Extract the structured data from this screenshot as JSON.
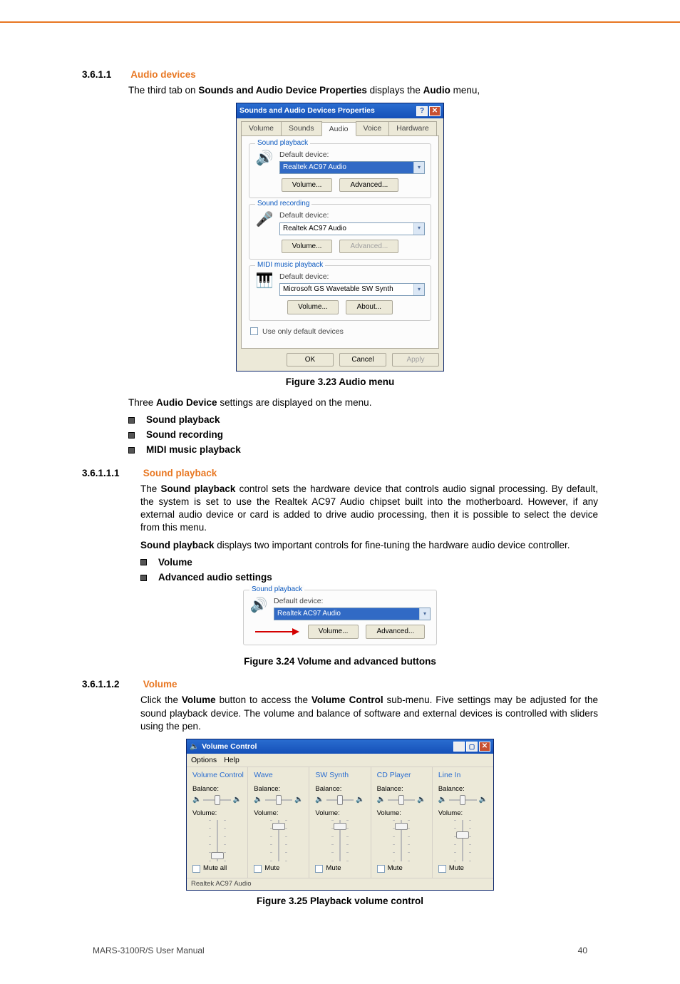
{
  "sections": {
    "s1": {
      "num": "3.6.1.1",
      "title": "Audio devices"
    },
    "s2": {
      "num": "3.6.1.1.1",
      "title": "Sound playback"
    },
    "s3": {
      "num": "3.6.1.1.2",
      "title": "Volume"
    }
  },
  "paras": {
    "p1a": "The third tab on ",
    "p1b": "Sounds and Audio Device Properties",
    "p1c": " displays the ",
    "p1d": "Audio",
    "p1e": " menu,",
    "p2a": "Three ",
    "p2b": "Audio Device",
    "p2c": " settings are displayed on the menu.",
    "p3a": "The ",
    "p3b": "Sound playback",
    "p3c": " control sets the hardware device that controls audio signal processing. By default, the system is set to use the Realtek AC97 Audio chipset built into the motherboard. However, if any external audio device or card is added to drive audio processing, then it is possible to select the device from this menu.",
    "p4a": "Sound playback",
    "p4b": " displays two important controls for fine-tuning the hardware audio device controller.",
    "p5a": "Click the ",
    "p5b": "Volume",
    "p5c": " button to access the ",
    "p5d": "Volume Control",
    "p5e": " sub-menu. Five settings may be adjusted for the sound playback device. The volume and balance of software and external devices is controlled with sliders using the pen."
  },
  "bullets1": [
    "Sound playback",
    "Sound recording",
    "MIDI music playback"
  ],
  "bullets2": [
    "Volume",
    "Advanced audio settings"
  ],
  "captions": {
    "c1": "Figure 3.23 Audio menu",
    "c2": "Figure 3.24 Volume and advanced buttons",
    "c3": "Figure 3.25 Playback volume control"
  },
  "dialog1": {
    "title": "Sounds and Audio Devices Properties",
    "tabs": [
      "Volume",
      "Sounds",
      "Audio",
      "Voice",
      "Hardware"
    ],
    "groups": {
      "g1": {
        "title": "Sound playback",
        "label": "Default device:",
        "device": "Realtek AC97 Audio",
        "btn1": "Volume...",
        "btn2": "Advanced..."
      },
      "g2": {
        "title": "Sound recording",
        "label": "Default device:",
        "device": "Realtek AC97 Audio",
        "btn1": "Volume...",
        "btn2": "Advanced..."
      },
      "g3": {
        "title": "MIDI music playback",
        "label": "Default device:",
        "device": "Microsoft GS Wavetable SW Synth",
        "btn1": "Volume...",
        "btn2": "About..."
      }
    },
    "useOnly": "Use only default devices",
    "ok": "OK",
    "cancel": "Cancel",
    "apply": "Apply"
  },
  "snippet": {
    "title": "Sound playback",
    "label": "Default device:",
    "device": "Realtek AC97 Audio",
    "btn1": "Volume...",
    "btn2": "Advanced..."
  },
  "volctrl": {
    "title": "Volume Control",
    "menu": [
      "Options",
      "Help"
    ],
    "cols": [
      {
        "title": "Volume Control",
        "balance": "Balance:",
        "volume": "Volume:",
        "mute": "Mute all",
        "vpos": 78
      },
      {
        "title": "Wave",
        "balance": "Balance:",
        "volume": "Volume:",
        "mute": "Mute",
        "vpos": 8
      },
      {
        "title": "SW Synth",
        "balance": "Balance:",
        "volume": "Volume:",
        "mute": "Mute",
        "vpos": 8
      },
      {
        "title": "CD Player",
        "balance": "Balance:",
        "volume": "Volume:",
        "mute": "Mute",
        "vpos": 8
      },
      {
        "title": "Line In",
        "balance": "Balance:",
        "volume": "Volume:",
        "mute": "Mute",
        "vpos": 28
      }
    ],
    "status": "Realtek AC97 Audio"
  },
  "footer": {
    "left": "MARS-3100R/S User Manual",
    "right": "40"
  }
}
